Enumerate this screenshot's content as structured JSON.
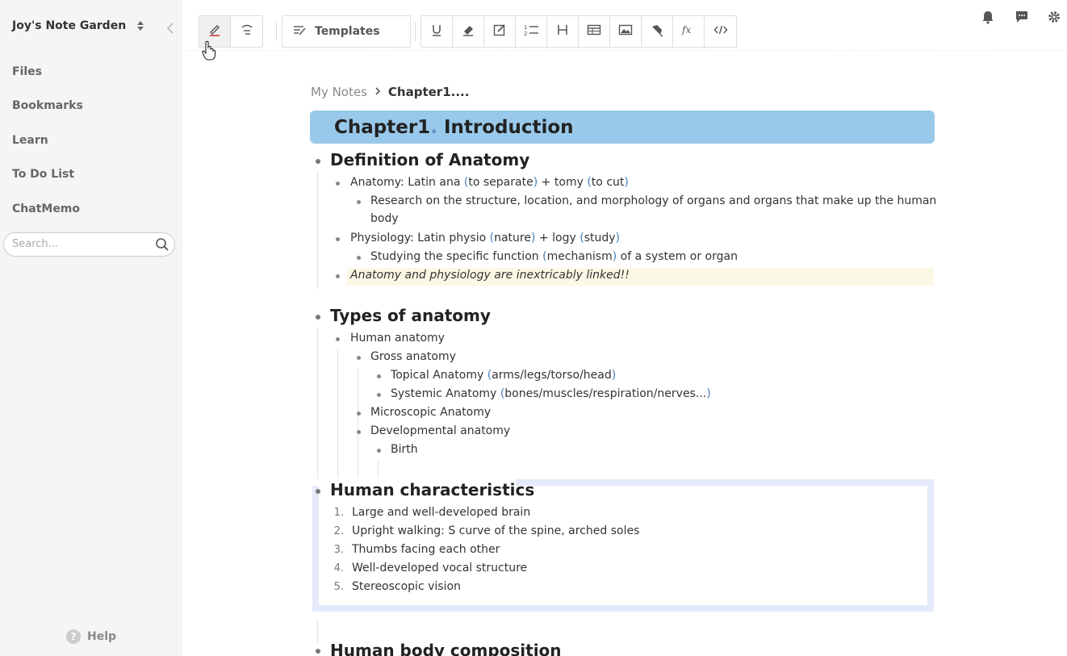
{
  "sidebar": {
    "workspace_title": "Joy's Note Garden",
    "nav": [
      "Files",
      "Bookmarks",
      "Learn",
      "To Do List",
      "ChatMemo"
    ],
    "search_placeholder": "Search...",
    "help_label": "Help"
  },
  "toolbar": {
    "templates_label": "Templates"
  },
  "breadcrumb": {
    "root": "My Notes",
    "current": "Chapter1...."
  },
  "chapter": {
    "title_main": "Chapter1",
    "title_dot": ".",
    "title_rest": " Introduction"
  },
  "sections": {
    "definition": {
      "heading": "Definition of Anatomy",
      "anatomy_line": "Anatomy: Latin ana (to separate) + tomy (to cut)",
      "anatomy_detail_1": "Research on the structure, location, and morphology of organs and organs that make up the human",
      "anatomy_detail_2": "body",
      "physiology_line": "Physiology: Latin physio (nature) + logy (study)",
      "physiology_detail": "Studying the specific function (mechanism) of a system or organ",
      "linked": "Anatomy and physiology are inextricably linked!!"
    },
    "types": {
      "heading": "Types of anatomy",
      "human": "Human anatomy",
      "gross": "Gross anatomy",
      "topical": "Topical Anatomy (arms/legs/torso/head)",
      "systemic": "Systemic Anatomy (bones/muscles/respiration/nerves...)",
      "microscopic": "Microscopic Anatomy",
      "developmental": "Developmental anatomy",
      "birth": "Birth"
    },
    "characteristics": {
      "heading": "Human characteristics",
      "items": [
        {
          "num": "1.",
          "text": "Large and well-developed brain"
        },
        {
          "num": "2.",
          "text": "Upright walking: S curve of the spine, arched soles"
        },
        {
          "num": "3.",
          "text": "Thumbs facing each other"
        },
        {
          "num": "4.",
          "text": "Well-developed vocal structure"
        },
        {
          "num": "5.",
          "text": "Stereoscopic vision"
        }
      ]
    },
    "composition": {
      "heading": "Human body composition"
    }
  }
}
